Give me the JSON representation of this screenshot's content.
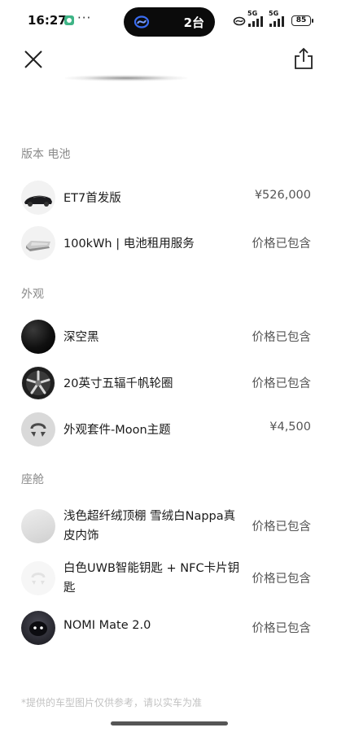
{
  "status_bar": {
    "time": "16:27",
    "more": "···",
    "island_count": "2台",
    "net1": "5G",
    "net2": "5G",
    "battery": "85"
  },
  "header": {
    "close_icon": "close-icon",
    "share_icon": "share-icon"
  },
  "sections": {
    "version": {
      "title": "版本 电池",
      "items": [
        {
          "label": "ET7首发版",
          "value": "¥526,000"
        },
        {
          "label": "100kWh | 电池租用服务",
          "value": "价格已包含"
        }
      ]
    },
    "exterior": {
      "title": "外观",
      "items": [
        {
          "label": "深空黑",
          "value": "价格已包含"
        },
        {
          "label": "20英寸五辐千帆轮圈",
          "value": "价格已包含"
        },
        {
          "label": "外观套件-Moon主题",
          "value": "¥4,500"
        }
      ]
    },
    "cabin": {
      "title": "座舱",
      "items": [
        {
          "label": "浅色超纤绒顶棚 雪绒白Nappa真皮内饰",
          "value": "价格已包含"
        },
        {
          "label": "白色UWB智能钥匙 + NFC卡片钥匙",
          "value": "价格已包含"
        },
        {
          "label": "NOMI Mate 2.0",
          "value": "价格已包含"
        }
      ]
    }
  },
  "footnote": "*提供的车型图片仅供参考，请以实车为准",
  "colors": {
    "accent_dark": "#0b0b0b",
    "muted_text": "#8a8a8a",
    "app_dot": "#3fb486"
  }
}
